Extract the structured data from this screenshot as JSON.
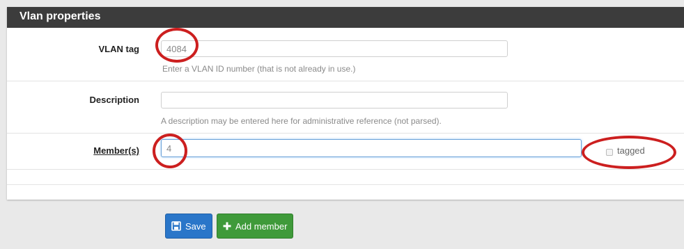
{
  "panel": {
    "title": "Vlan properties"
  },
  "form": {
    "vlan_tag": {
      "label": "VLAN tag",
      "value": "4084",
      "help": "Enter a VLAN ID number (that is not already in use.)"
    },
    "description": {
      "label": "Description",
      "value": "",
      "help": "A description may be entered here for administrative reference (not parsed)."
    },
    "members": {
      "label": "Member(s)",
      "value": "4",
      "tagged_label": "tagged",
      "tagged_checked": false
    }
  },
  "buttons": {
    "save_label": "Save",
    "add_member_label": "Add member"
  },
  "colors": {
    "annotation_circle": "#cc1f1f",
    "save_button": "#2a76c9",
    "add_button": "#3f9a3a",
    "header": "#3c3c3c"
  },
  "icons": {
    "save": "floppy-disk-icon",
    "add": "plus-icon"
  }
}
